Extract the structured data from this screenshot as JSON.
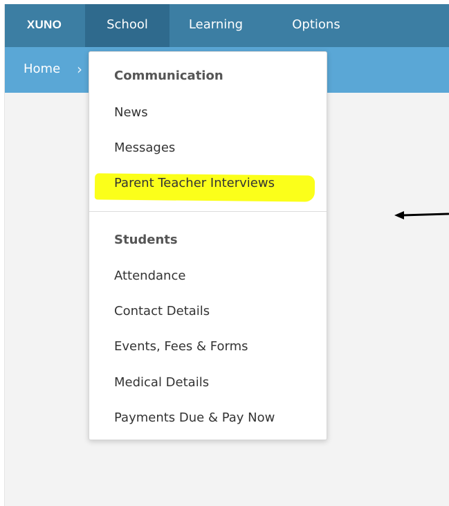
{
  "header": {
    "brand": "XUNO",
    "nav": {
      "school": "School",
      "learning": "Learning",
      "options": "Options"
    }
  },
  "breadcrumb": {
    "home": "Home",
    "separator": "›"
  },
  "dropdown": {
    "communication_heading": "Communication",
    "communication_items": [
      "News",
      "Messages",
      "Parent Teacher Interviews"
    ],
    "students_heading": "Students",
    "students_items": [
      "Attendance",
      "Contact Details",
      "Events, Fees & Forms",
      "Medical Details",
      "Payments Due & Pay Now"
    ]
  },
  "colors": {
    "nav_bg": "#3c7ea3",
    "nav_active_bg": "#2f6a8d",
    "breadcrumb_bg": "#5aa7d6",
    "highlight": "#fbff1a"
  },
  "annotation": {
    "arrow_icon": "left-arrow-icon"
  }
}
